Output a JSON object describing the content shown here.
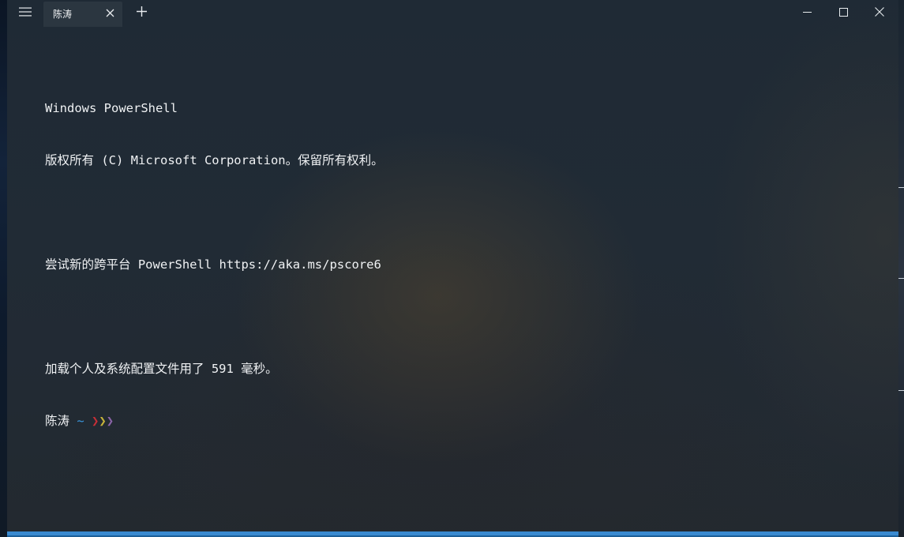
{
  "window": {
    "tab_title": "陈涛"
  },
  "terminal": {
    "lines": [
      "Windows PowerShell",
      "版权所有 (C) Microsoft Corporation。保留所有权利。",
      "",
      "尝试新的跨平台 PowerShell https://aka.ms/pscore6",
      "",
      "加载个人及系统配置文件用了 591 毫秒。"
    ],
    "prompt": {
      "user": "陈涛",
      "path": "~",
      "chevrons": [
        "❯",
        "❯",
        "❯"
      ],
      "chevron_colors": [
        "#c62f37",
        "#c7b43a",
        "#8a64a8"
      ]
    }
  },
  "colors": {
    "accent": "#3a8ad0",
    "path": "#3a96dd",
    "text": "#f0f2f4"
  },
  "icons": {
    "menu": "hamburger-menu-icon",
    "tab_close": "close-icon",
    "new_tab": "plus-icon",
    "minimize": "minimize-icon",
    "maximize": "maximize-icon",
    "close": "close-icon"
  }
}
